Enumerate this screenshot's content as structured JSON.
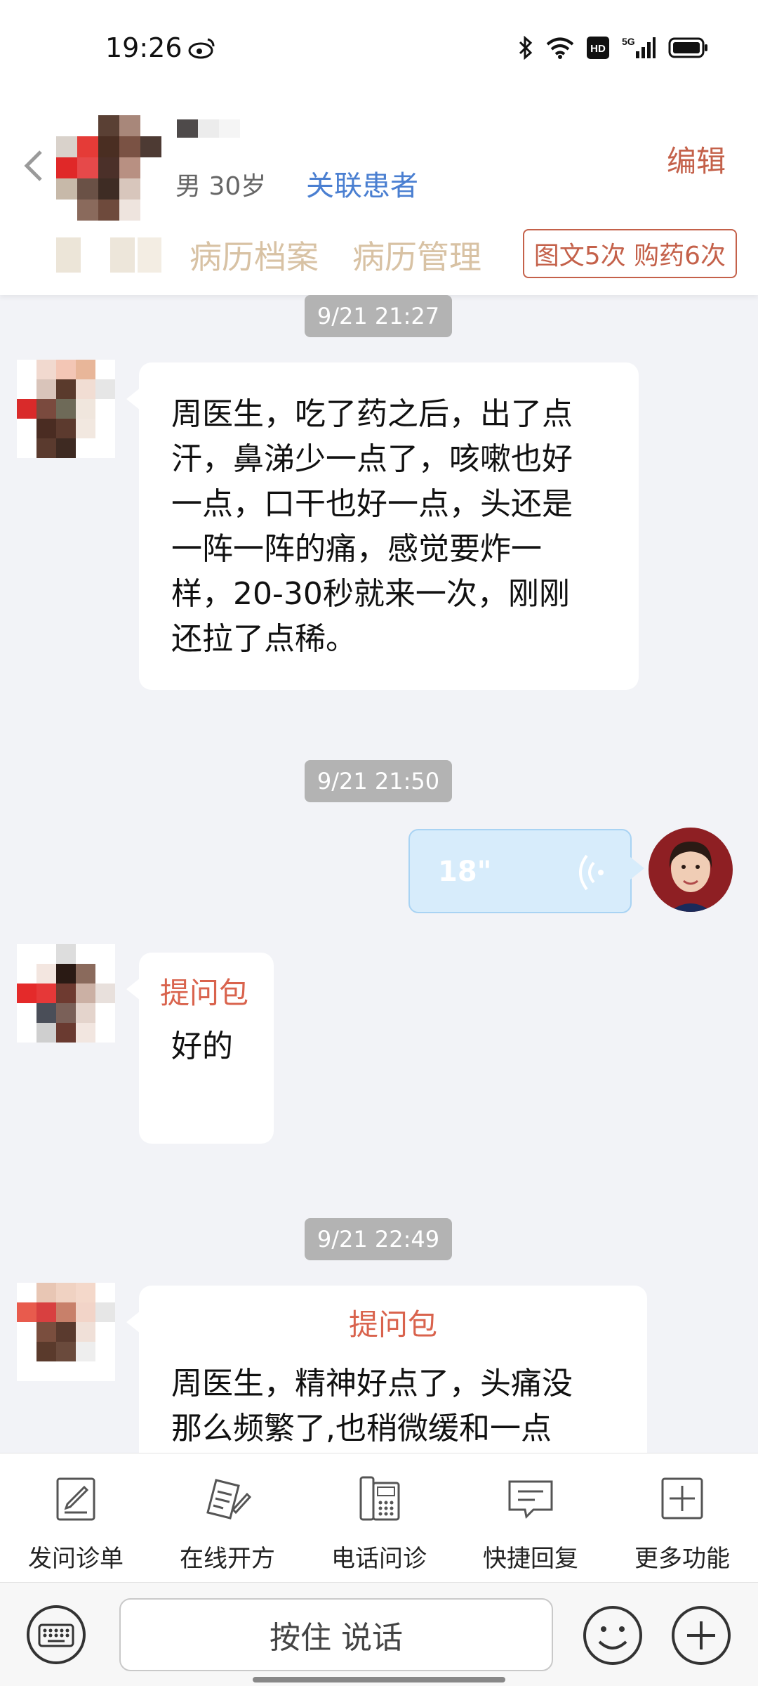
{
  "status_bar": {
    "time": "19:26",
    "icons": [
      "weibo-icon",
      "bluetooth-icon",
      "wifi-icon",
      "hd-icon",
      "signal-5g-icon",
      "battery-icon"
    ],
    "hd_label": "HD",
    "network_label": "5G"
  },
  "header": {
    "back_icon": "chevron-left-icon",
    "patient_info": "男 30岁",
    "link_patient": "关联患者",
    "edit": "编辑",
    "tabs": [
      "病历档案",
      "病历管理"
    ],
    "blurred_tab_partial": "单",
    "quota": "图文5次 购药6次"
  },
  "chat": {
    "timestamps": [
      "9/21 21:27",
      "9/21 21:50",
      "9/21 22:49"
    ],
    "message_1": {
      "lines": [
        "周医生，吃了药之后，出了点",
        "汗，鼻涕少一点了，咳嗽也好",
        "一点，口干也好一点，头还是",
        "一阵一阵的痛，感觉要炸一",
        "样，20-30秒就来一次，刚刚",
        "还拉了点稀。"
      ]
    },
    "voice_message": {
      "duration": "18\""
    },
    "message_2": {
      "title": "提问包",
      "text": "好的"
    },
    "message_3": {
      "title": "提问包",
      "lines": [
        "周医生，精神好点了，头痛没",
        "那么频繁了,也稍微缓和一点"
      ]
    }
  },
  "function_bar": [
    {
      "label": "发问诊单",
      "icon": "form-edit-icon"
    },
    {
      "label": "在线开方",
      "icon": "prescription-icon"
    },
    {
      "label": "电话问诊",
      "icon": "phone-icon"
    },
    {
      "label": "快捷回复",
      "icon": "message-icon"
    },
    {
      "label": "更多功能",
      "icon": "plus-box-icon"
    }
  ],
  "input_bar": {
    "hold_to_talk": "按住 说话",
    "icons": [
      "keyboard-icon",
      "emoji-icon",
      "plus-circle-icon"
    ]
  },
  "colors": {
    "accent": "#c4614a",
    "link": "#4a7fd1",
    "tab_text": "#d8c2a4",
    "pack_title": "#d9634d",
    "voice_bubble": "#d7ecfb",
    "chat_bg": "#f2f3f7"
  }
}
